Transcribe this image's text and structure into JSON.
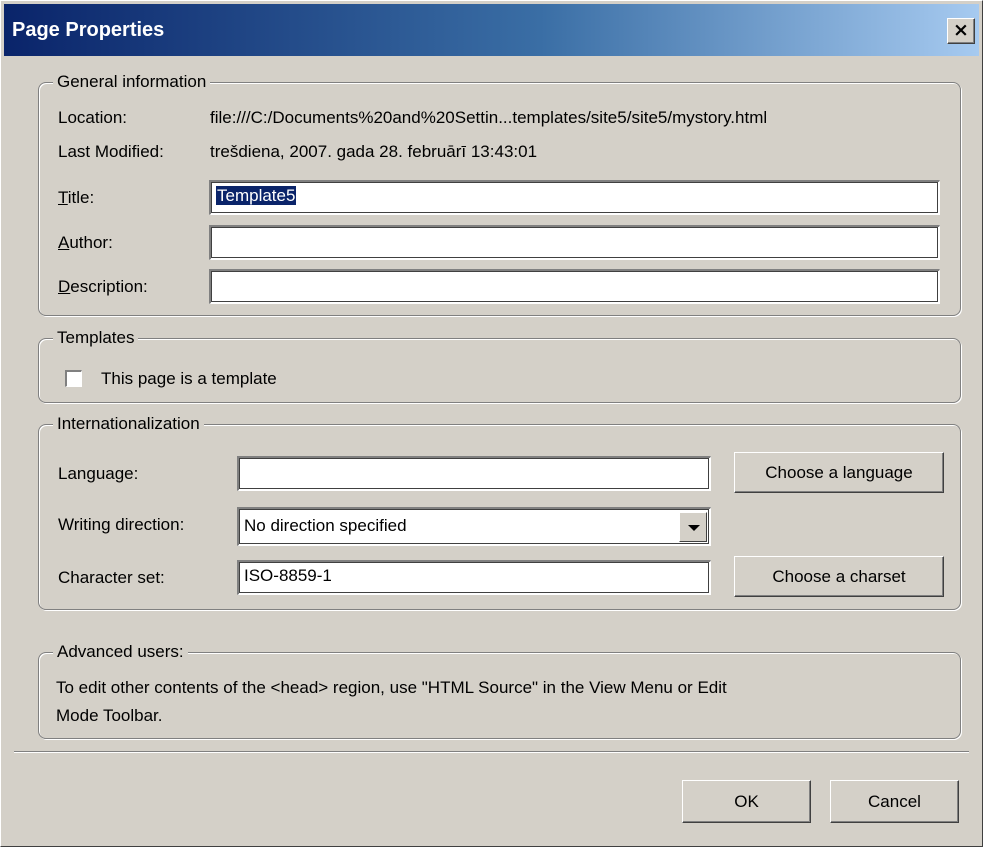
{
  "dialog": {
    "title": "Page Properties",
    "close_label": "×"
  },
  "general": {
    "legend": "General information",
    "location_label": "Location:",
    "location_value": "file:///C:/Documents%20and%20Settin...templates/site5/site5/mystory.html",
    "modified_label": "Last Modified:",
    "modified_value": "trešdiena, 2007. gada 28. februārī 13:43:01",
    "title_label_key": "T",
    "title_label_rest": "itle:",
    "title_value": "Template5",
    "author_label_key": "A",
    "author_label_rest": "uthor:",
    "author_value": "",
    "description_label_key": "D",
    "description_label_rest": "escription:",
    "description_value": ""
  },
  "templates": {
    "legend": "Templates",
    "checkbox_label": "This page is a template",
    "checked": false
  },
  "i18n": {
    "legend": "Internationalization",
    "language_label": "Language:",
    "language_value": "",
    "choose_language_button": "Choose a language",
    "direction_label": "Writing direction:",
    "direction_value": "No direction specified",
    "charset_label": "Character set:",
    "charset_value": "ISO-8859-1",
    "choose_charset_button": "Choose a charset"
  },
  "advanced": {
    "legend": "Advanced users:",
    "text_line1": "To edit other contents of the <head> region, use \"HTML Source\" in the View Menu or Edit",
    "text_line2": "Mode Toolbar."
  },
  "footer": {
    "ok_button": "OK",
    "cancel_button": "Cancel"
  }
}
